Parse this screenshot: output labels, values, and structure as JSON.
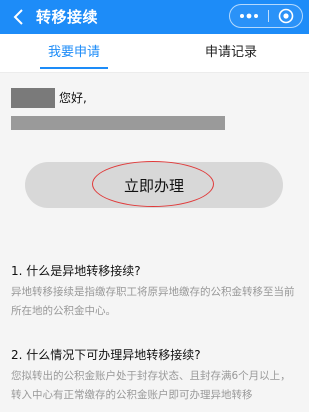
{
  "header": {
    "title": "转移接续",
    "back_icon": "chevron-left-icon",
    "more_icon": "more-dots-icon",
    "close_icon": "target-close-icon",
    "color": "#1d8cf8"
  },
  "tabs": [
    {
      "label": "我要申请",
      "active": true
    },
    {
      "label": "申请记录",
      "active": false
    }
  ],
  "greeting": {
    "suffix": "您好,"
  },
  "action_button": {
    "label": "立即办理"
  },
  "faq": [
    {
      "question": "1. 什么是异地转移接续?",
      "answer": "异地转移接续是指缴存职工将原异地缴存的公积金转移至当前所在地的公积金中心。"
    },
    {
      "question": "2. 什么情况下可办理异地转移接续?",
      "answer": "您拟转出的公积金账户处于封存状态、且封存满6个月以上，转入中心有正常缴存的公积金账户即可办理异地转移"
    }
  ]
}
